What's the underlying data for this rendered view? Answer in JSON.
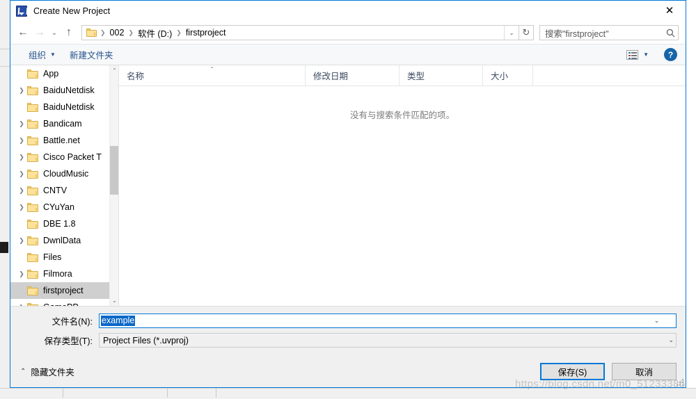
{
  "window": {
    "title": "Create New Project",
    "app_icon": "keil-uvision-icon",
    "close_label": "✕"
  },
  "address_bar": {
    "back_icon": "←",
    "forward_icon": "→",
    "recent_icon": "⌄",
    "up_icon": "↑",
    "breadcrumb_folder_icon": "folder-icon",
    "breadcrumb": [
      "002",
      "软件 (D:)",
      "firstproject"
    ],
    "separator": "❯",
    "dropdown_icon": "⌄",
    "refresh_icon": "↻",
    "search_placeholder": "搜索\"firstproject\"",
    "search_icon": "⚲"
  },
  "command_bar": {
    "organize_label": "组织",
    "organize_caret": "▼",
    "new_folder_label": "新建文件夹",
    "view_caret": "▼",
    "help_label": "?"
  },
  "nav_pane": {
    "items": [
      {
        "label": "App",
        "expandable": false,
        "selected": false
      },
      {
        "label": "BaiduNetdisk",
        "expandable": true,
        "selected": false
      },
      {
        "label": "BaiduNetdisk",
        "expandable": false,
        "selected": false
      },
      {
        "label": "Bandicam",
        "expandable": true,
        "selected": false
      },
      {
        "label": "Battle.net",
        "expandable": true,
        "selected": false
      },
      {
        "label": "Cisco Packet T",
        "expandable": true,
        "selected": false
      },
      {
        "label": "CloudMusic",
        "expandable": true,
        "selected": false
      },
      {
        "label": "CNTV",
        "expandable": true,
        "selected": false
      },
      {
        "label": "CYuYan",
        "expandable": true,
        "selected": false
      },
      {
        "label": "DBE 1.8",
        "expandable": false,
        "selected": false
      },
      {
        "label": "DwnlData",
        "expandable": true,
        "selected": false
      },
      {
        "label": "Files",
        "expandable": false,
        "selected": false
      },
      {
        "label": "Filmora",
        "expandable": true,
        "selected": false
      },
      {
        "label": "firstproject",
        "expandable": false,
        "selected": true
      },
      {
        "label": "GamePP",
        "expandable": true,
        "selected": false
      }
    ],
    "chevron_collapsed": "❯",
    "scroll_up_icon": "⌃",
    "scroll_down_icon": "⌄"
  },
  "file_list": {
    "columns": [
      {
        "key": "name",
        "label": "名称",
        "sorted": true,
        "sort_caret": "⌃"
      },
      {
        "key": "date",
        "label": "修改日期",
        "sorted": false
      },
      {
        "key": "type",
        "label": "类型",
        "sorted": false
      },
      {
        "key": "size",
        "label": "大小",
        "sorted": false
      }
    ],
    "rows": [],
    "empty_message": "没有与搜索条件匹配的项。"
  },
  "form": {
    "filename_label": "文件名(N):",
    "filename_value": "example",
    "filename_selected": true,
    "filename_caret": "⌄",
    "filetype_label": "保存类型(T):",
    "filetype_value": "Project Files (*.uvproj)",
    "filetype_caret": "⌄"
  },
  "footer": {
    "hide_folders_label": "隐藏文件夹",
    "hide_folders_chevron": "⌃",
    "save_label": "保存(S)",
    "cancel_label": "取消"
  },
  "watermark": {
    "text": "https://blog.csdn.net/m0_51233386"
  },
  "colors": {
    "accent": "#0078d7",
    "selection": "#0a68c8",
    "tree_selected": "#cfcfcf",
    "command_link": "#23528c",
    "folder_fill": "#fde29a",
    "folder_stroke": "#d7ae45",
    "help_blue": "#1565a8",
    "chrome_gray": "#f0f0f0"
  }
}
